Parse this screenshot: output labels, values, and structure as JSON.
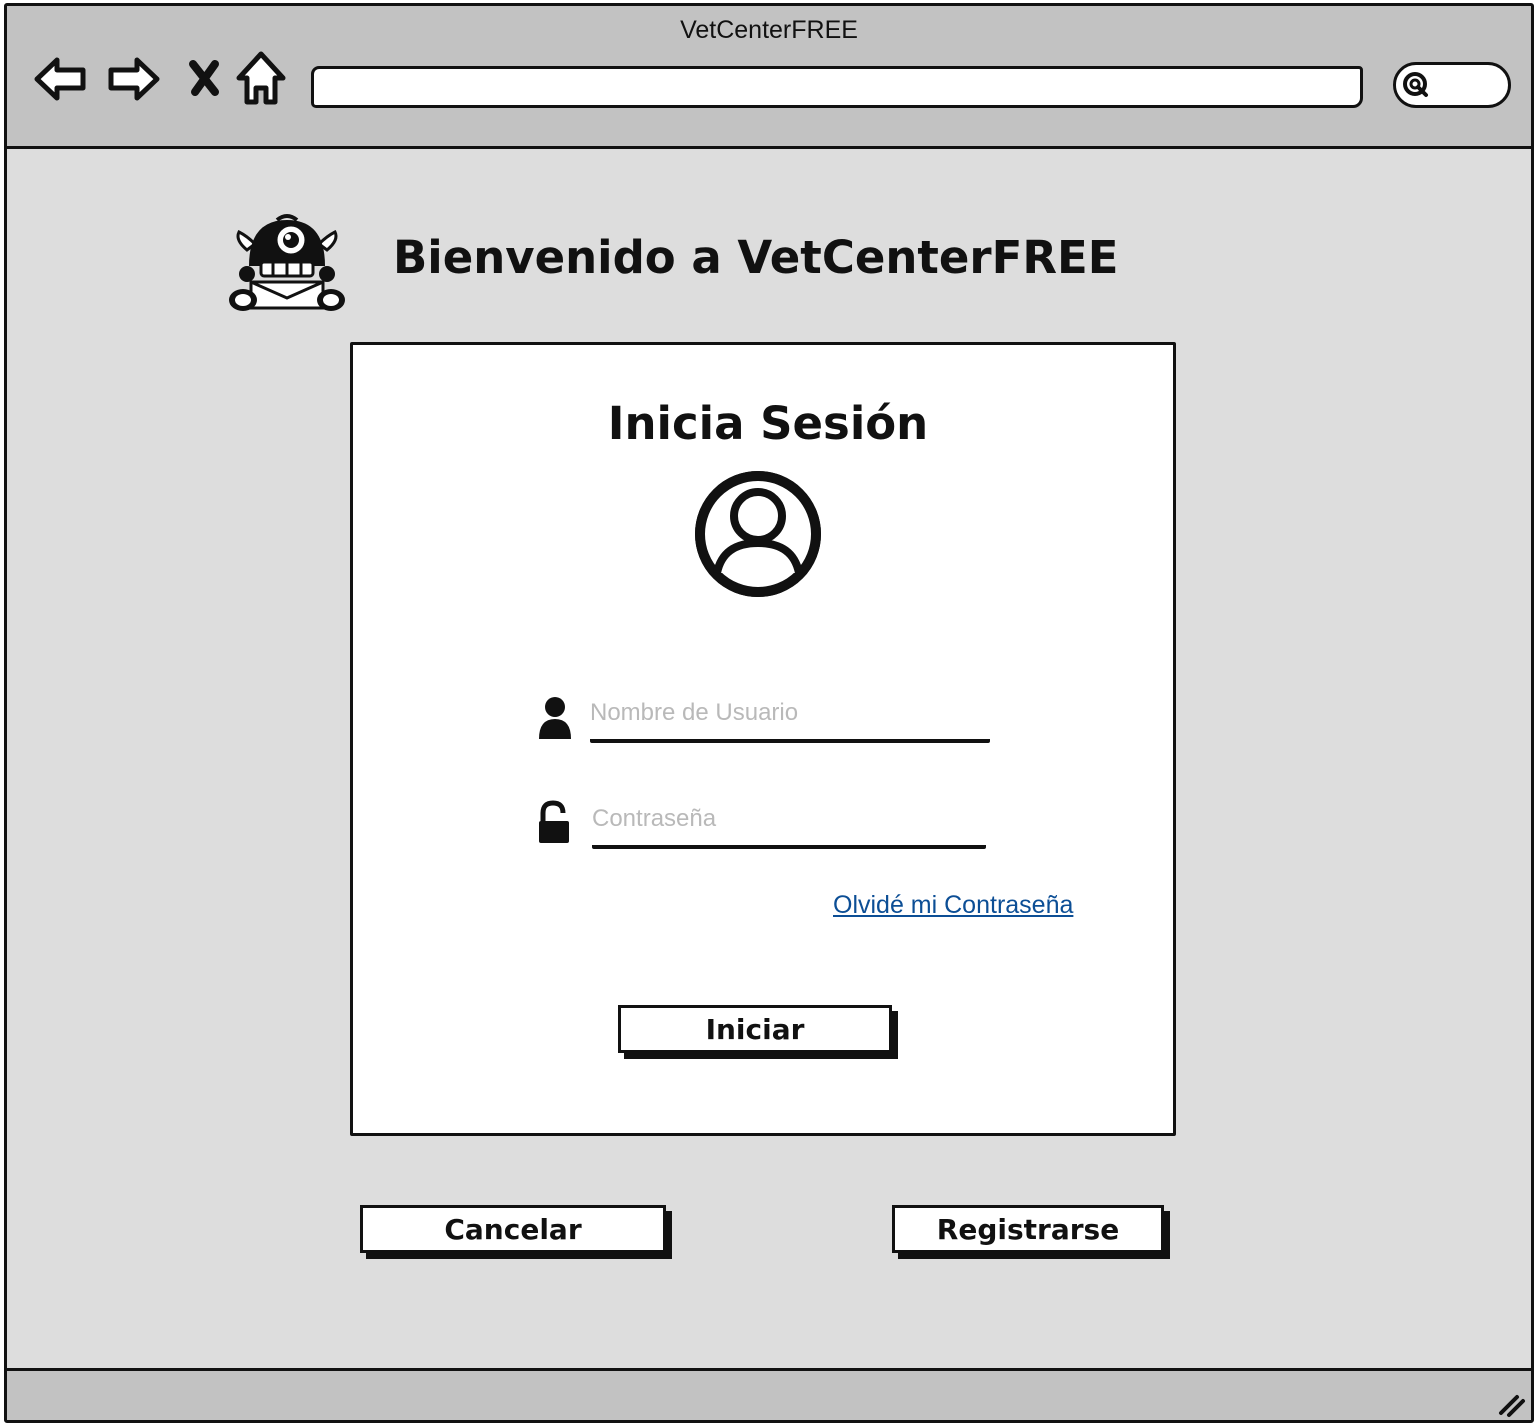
{
  "window": {
    "title": "VetCenterFREE"
  },
  "toolbar": {
    "back_icon": "back-arrow-icon",
    "forward_icon": "forward-arrow-icon",
    "stop_icon": "close-x-icon",
    "home_icon": "home-icon",
    "url_value": "",
    "search_icon": "search-icon",
    "search_value": ""
  },
  "header": {
    "logo_icon": "monster-mascot-logo",
    "welcome": "Bienvenido a VetCenterFREE"
  },
  "login": {
    "title": "Inicia Sesión",
    "avatar_icon": "user-avatar-icon",
    "username": {
      "icon": "user-icon",
      "placeholder": "Nombre de Usuario",
      "value": ""
    },
    "password": {
      "icon": "unlocked-padlock-icon",
      "placeholder": "Contraseña",
      "value": ""
    },
    "forgot_link": "Olvidé mi Contraseña",
    "submit_label": "Iniciar"
  },
  "actions": {
    "cancel_label": "Cancelar",
    "register_label": "Registrarse"
  },
  "colors": {
    "window_bg": "#dddddd",
    "titlebar_bg": "#c2c2c2",
    "card_bg": "#ffffff",
    "link": "#0c4e95",
    "placeholder": "#b9b9b9",
    "stroke": "#111111"
  }
}
